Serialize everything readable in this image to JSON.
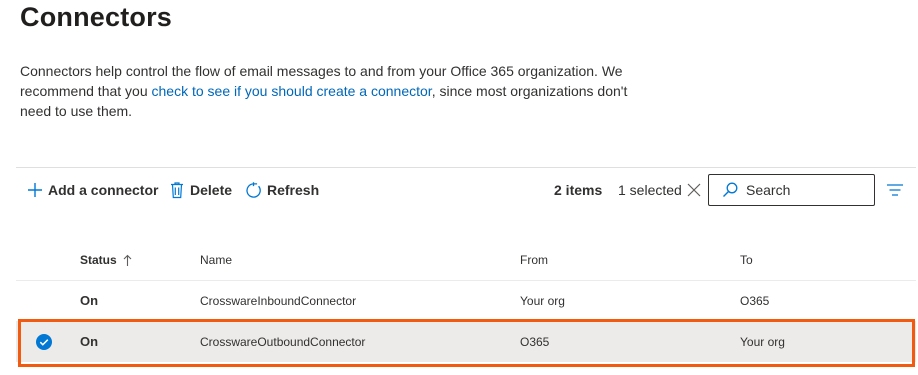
{
  "page": {
    "title": "Connectors",
    "description_before": "Connectors help control the flow of email messages to and from your Office 365 organization. We recommend that you ",
    "description_link": "check to see if you should create a connector",
    "description_after": ", since most organizations don't need to use them."
  },
  "toolbar": {
    "add_label": "Add a connector",
    "delete_label": "Delete",
    "refresh_label": "Refresh",
    "items_count": "2 items",
    "selected_count": "1 selected",
    "search_placeholder": "Search"
  },
  "table": {
    "columns": {
      "status": "Status",
      "name": "Name",
      "from": "From",
      "to": "To"
    },
    "sort": "status-ascending",
    "rows": [
      {
        "status": "On",
        "name": "CrosswareInboundConnector",
        "from": "Your org",
        "to": "O365",
        "selected": false
      },
      {
        "status": "On",
        "name": "CrosswareOutboundConnector",
        "from": "O365",
        "to": "Your org",
        "selected": true
      }
    ]
  },
  "colors": {
    "accent": "#0078d4",
    "link": "#0067b8",
    "highlight": "#f25a0f",
    "selected_row": "#edebe9"
  },
  "icons": [
    "plus-icon",
    "trash-icon",
    "refresh-icon",
    "close-icon",
    "search-icon",
    "filter-icon",
    "sort-up-icon",
    "check-circle-icon"
  ]
}
